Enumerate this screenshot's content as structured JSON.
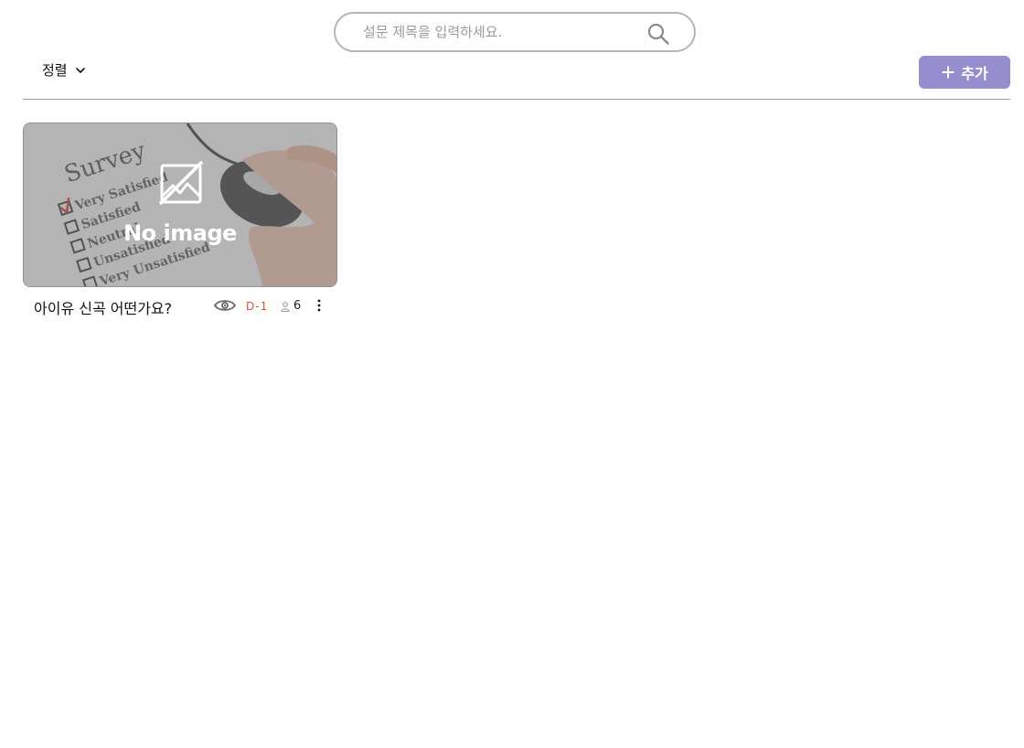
{
  "search": {
    "placeholder": "설문 제목을 입력하세요.",
    "value": "",
    "icon": "search-icon"
  },
  "toolbar": {
    "sort_label": "정렬",
    "sort_icon": "chevron-down-icon",
    "add_label": "추가",
    "add_icon": "plus-icon",
    "accent_color": "#968dcf"
  },
  "surveys": [
    {
      "title": "아이유 신곡 어떤가요?",
      "thumbnail_text": "No image",
      "thumbnail_icon": "no-image-icon",
      "visibility_icon": "eye-icon",
      "dday": "D-1",
      "dday_color": "#d4582e",
      "participants_icon": "person-icon",
      "participants": "6",
      "menu_icon": "more-vertical-icon"
    }
  ],
  "thumbnail_art": {
    "heading": "Survey",
    "options": [
      "Very Satisfied",
      "Satisfied",
      "Neutral",
      "Unsatisfied",
      "Very Unsatisfied"
    ]
  }
}
